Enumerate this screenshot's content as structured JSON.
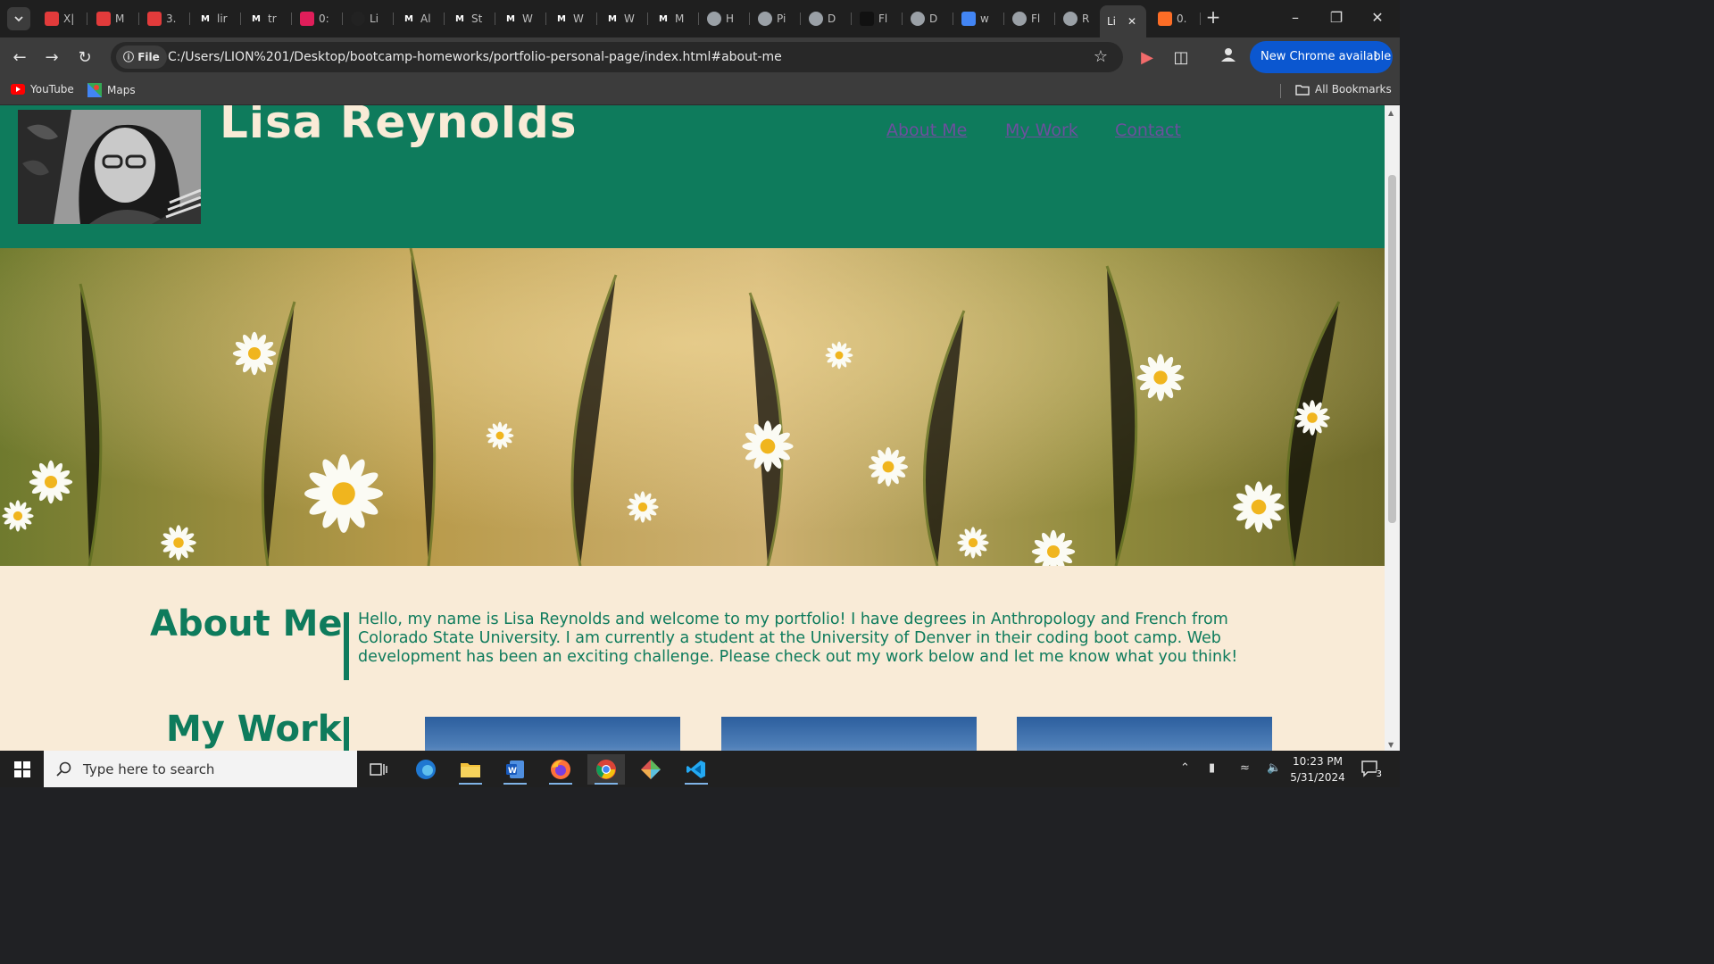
{
  "browser": {
    "tabs": [
      {
        "label": "X|",
        "favicon": "shield-icon",
        "color": "#e23b3b"
      },
      {
        "label": "M",
        "favicon": "shield-icon",
        "color": "#e23b3b"
      },
      {
        "label": "3.",
        "favicon": "shield-icon",
        "color": "#e23b3b"
      },
      {
        "label": "lir",
        "favicon": "m-logo-icon",
        "color": "#ffffff"
      },
      {
        "label": "tr",
        "favicon": "m-logo-icon",
        "color": "#ffffff"
      },
      {
        "label": "0:",
        "favicon": "slack-icon",
        "color": "#e01e5a"
      },
      {
        "label": "Li",
        "favicon": "github-icon",
        "color": "#222222"
      },
      {
        "label": "Al",
        "favicon": "m-logo-icon",
        "color": "#ffffff"
      },
      {
        "label": "St",
        "favicon": "m-logo-icon",
        "color": "#ffffff"
      },
      {
        "label": "W",
        "favicon": "m-logo-icon",
        "color": "#ffffff"
      },
      {
        "label": "W",
        "favicon": "m-logo-icon",
        "color": "#ffffff"
      },
      {
        "label": "W",
        "favicon": "m-logo-icon",
        "color": "#ffffff"
      },
      {
        "label": "M",
        "favicon": "m-logo-icon",
        "color": "#ffffff"
      },
      {
        "label": "H",
        "favicon": "globe-icon",
        "color": "#9aa0a6"
      },
      {
        "label": "Pi",
        "favicon": "globe-icon",
        "color": "#9aa0a6"
      },
      {
        "label": "D",
        "favicon": "globe-icon",
        "color": "#9aa0a6"
      },
      {
        "label": "Fl",
        "favicon": "folder-icon",
        "color": "#111111"
      },
      {
        "label": "D",
        "favicon": "globe-icon",
        "color": "#9aa0a6"
      },
      {
        "label": "w",
        "favicon": "google-icon",
        "color": "#4285f4"
      },
      {
        "label": "Fl",
        "favicon": "globe-icon",
        "color": "#9aa0a6"
      },
      {
        "label": "R",
        "favicon": "globe-icon",
        "color": "#9aa0a6"
      },
      {
        "label": "Li",
        "favicon": "none",
        "color": "#9aa0a6",
        "active": true
      },
      {
        "label": "0.",
        "favicon": "gitlab-icon",
        "color": "#fc6d26"
      }
    ],
    "new_tab": "+",
    "address": {
      "chip": "File",
      "url": "C:/Users/LION%201/Desktop/bootcamp-homeworks/portfolio-personal-page/index.html#about-me"
    },
    "new_chrome": "New Chrome available",
    "bookmarks": {
      "youtube": "YouTube",
      "maps": "Maps",
      "all": "All Bookmarks"
    }
  },
  "page": {
    "name": "Lisa Reynolds",
    "nav": [
      "About Me",
      "My Work",
      "Contact"
    ],
    "about": {
      "title": "About Me",
      "text": "Hello, my name is Lisa Reynolds and welcome to my portfolio! I have degrees in Anthropology and French from Colorado State University. I am currently a student at the University of Denver in their coding boot camp. Web development has been an exciting challenge. Please check out my work below and let me know what you think!"
    },
    "work": {
      "title": "My Work"
    },
    "colors": {
      "header_bg": "#0e7b5c",
      "page_bg": "#f9ebd7",
      "accent": "#0e7b5c",
      "link": "#6d4f9e"
    }
  },
  "taskbar": {
    "search_placeholder": "Type here to search",
    "time": "10:23 PM",
    "date": "5/31/2024",
    "notifications": "3"
  }
}
